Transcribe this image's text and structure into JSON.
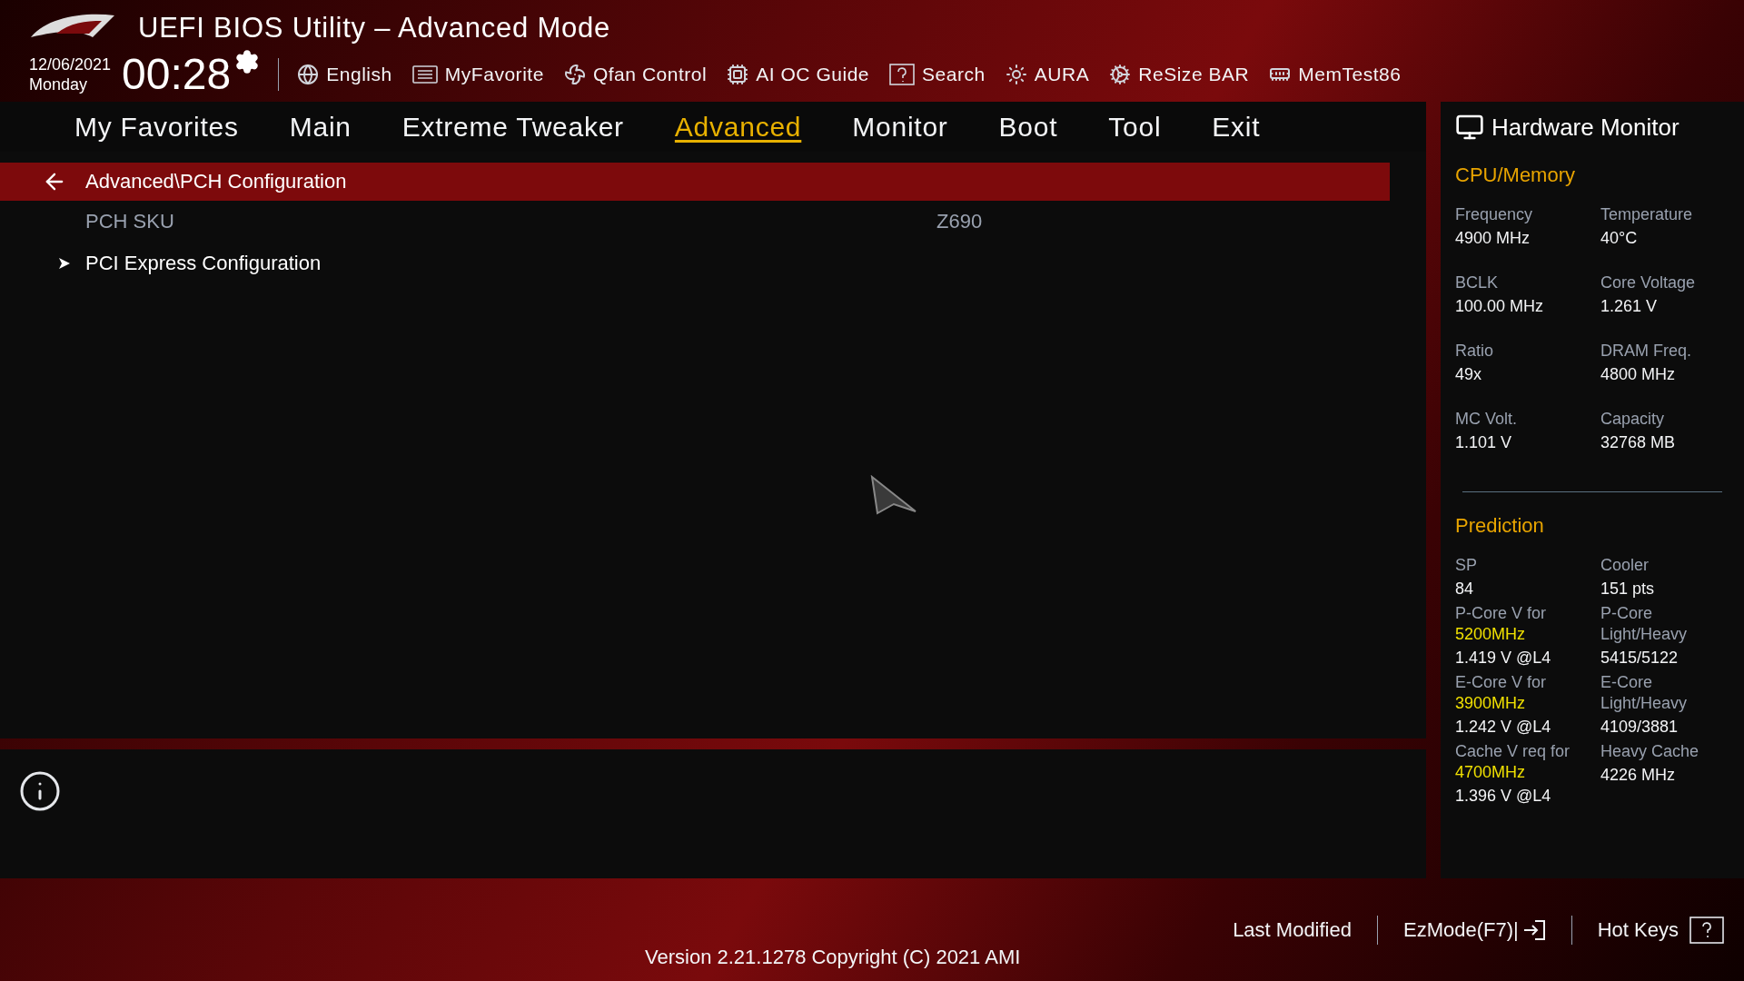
{
  "header": {
    "title": "UEFI BIOS Utility – Advanced Mode",
    "date": "12/06/2021",
    "day": "Monday",
    "time": "00:28"
  },
  "toolbar": [
    "English",
    "MyFavorite",
    "Qfan Control",
    "AI OC Guide",
    "Search",
    "AURA",
    "ReSize BAR",
    "MemTest86"
  ],
  "tabs": [
    {
      "label": "My Favorites",
      "selected": false
    },
    {
      "label": "Main",
      "selected": false
    },
    {
      "label": "Extreme Tweaker",
      "selected": false
    },
    {
      "label": "Advanced",
      "selected": true
    },
    {
      "label": "Monitor",
      "selected": false
    },
    {
      "label": "Boot",
      "selected": false
    },
    {
      "label": "Tool",
      "selected": false
    },
    {
      "label": "Exit",
      "selected": false
    }
  ],
  "breadcrumb": "Advanced\\PCH Configuration",
  "items": [
    {
      "kind": "info",
      "label": "PCH SKU",
      "value": "Z690"
    },
    {
      "kind": "submenu",
      "label": "PCI Express Configuration"
    }
  ],
  "hardware_monitor": {
    "title": "Hardware Monitor",
    "sections": [
      {
        "title": "CPU/Memory",
        "rows": [
          [
            {
              "label": "Frequency",
              "value": "4900 MHz"
            },
            {
              "label": "Temperature",
              "value": "40°C"
            }
          ],
          [
            {
              "label": "BCLK",
              "value": "100.00 MHz"
            },
            {
              "label": "Core Voltage",
              "value": "1.261 V"
            }
          ],
          [
            {
              "label": "Ratio",
              "value": "49x"
            },
            {
              "label": "DRAM Freq.",
              "value": "4800 MHz"
            }
          ],
          [
            {
              "label": "MC Volt.",
              "value": "1.101 V"
            },
            {
              "label": "Capacity",
              "value": "32768 MB"
            }
          ]
        ]
      },
      {
        "title": "Prediction",
        "rows": [
          [
            {
              "label": "SP",
              "value": "84"
            },
            {
              "label": "Cooler",
              "value": "151 pts"
            }
          ],
          [
            {
              "label": "P-Core V for",
              "highlight": "5200MHz",
              "value": "1.419 V @L4"
            },
            {
              "label": "P-Core Light/Heavy",
              "value": "5415/5122"
            }
          ],
          [
            {
              "label": "E-Core V for",
              "highlight": "3900MHz",
              "value": "1.242 V @L4"
            },
            {
              "label": "E-Core Light/Heavy",
              "value": "4109/3881"
            }
          ],
          [
            {
              "label": "Cache V req for",
              "highlight": "4700MHz",
              "value": "1.396 V @L4"
            },
            {
              "label": "Heavy Cache",
              "value": "4226 MHz"
            }
          ]
        ]
      }
    ]
  },
  "footer": {
    "buttons": [
      "Last Modified",
      "EzMode(F7)|",
      "Hot Keys"
    ],
    "version": "Version 2.21.1278 Copyright (C) 2021 AMI"
  }
}
